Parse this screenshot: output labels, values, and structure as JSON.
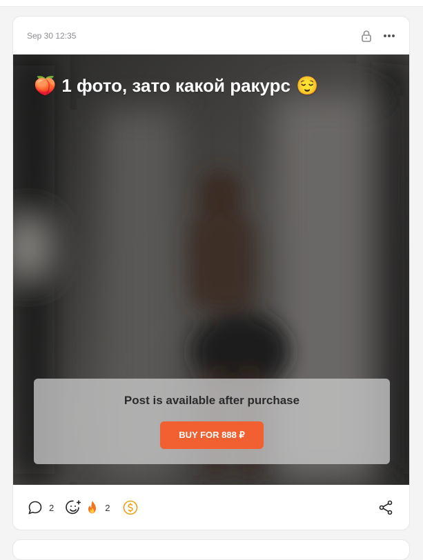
{
  "post": {
    "date": "Sep 30 12:35",
    "title_emoji": "🍑",
    "title_text": "1 фото, зато какой ракурс",
    "title_emoji_end": "😌",
    "paywall_text": "Post is available after purchase",
    "buy_label": "BUY FOR 888 ₽"
  },
  "footer": {
    "comments_count": "2",
    "reactions_count": "2"
  },
  "icons": {
    "lock": "lock-icon",
    "more": "more-icon",
    "comment": "comment-icon",
    "add_reaction": "add-reaction-icon",
    "fire": "fire-icon",
    "tip": "dollar-coin-icon",
    "share": "share-icon"
  },
  "colors": {
    "accent": "#f06030",
    "tip_gold": "#e8a317",
    "text_muted": "#8e8e93"
  }
}
